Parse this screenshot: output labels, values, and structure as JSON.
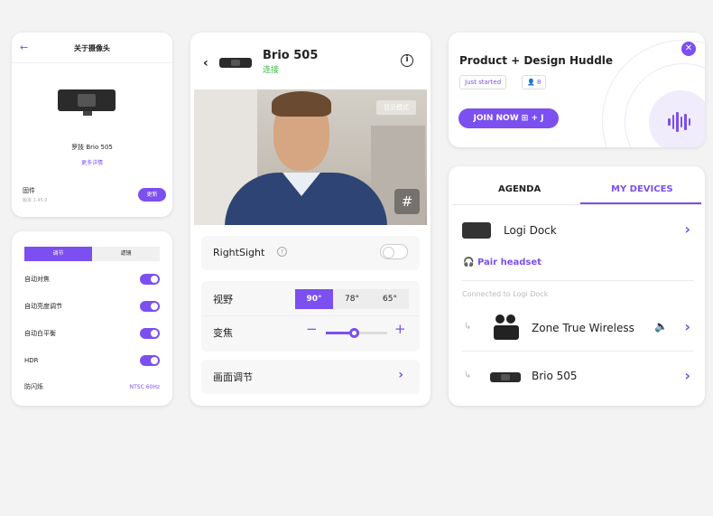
{
  "camera_info": {
    "title": "关于摄像头",
    "device_name": "罗技 Brio 505",
    "more_details": "更多详情",
    "firmware_label": "固件",
    "firmware_version": "版本 1.45.0",
    "update_button": "更新"
  },
  "settings": {
    "tabs": [
      {
        "label": "调节",
        "active": true
      },
      {
        "label": "滤镜",
        "active": false
      }
    ],
    "rows": [
      {
        "label": "自动对焦",
        "value": "on"
      },
      {
        "label": "自动亮度调节",
        "value": "on"
      },
      {
        "label": "自动白平衡",
        "value": "on"
      },
      {
        "label": "HDR",
        "value": "on"
      },
      {
        "label": "防闪烁",
        "value": "NTSC 60Hz"
      }
    ]
  },
  "device_panel": {
    "title": "Brio 505",
    "status": "连接",
    "video_mode_label": "显示模式",
    "rightsight_label": "RightSight",
    "rightsight_enabled": false,
    "fov_label": "视野",
    "fov_options": [
      "90°",
      "78°",
      "65°"
    ],
    "fov_selected": "90°",
    "zoom_label": "变焦",
    "zoom_level_fraction": 0.45,
    "image_adjust_label": "画面调节"
  },
  "meeting": {
    "title": "Product + Design Huddle",
    "status_pill": "Just started",
    "participants": "8",
    "join_button": "JOIN NOW",
    "join_shortcut": "+ J"
  },
  "devices": {
    "tabs": [
      {
        "label": "AGENDA",
        "active": false
      },
      {
        "label": "MY DEVICES",
        "active": true
      }
    ],
    "dock_name": "Logi Dock",
    "pair_headset": "Pair headset",
    "connected_caption": "Connected to Logi Dock",
    "connected": [
      {
        "name": "Zone True Wireless"
      },
      {
        "name": "Brio 505"
      }
    ]
  },
  "colors": {
    "accent": "#7b4ff0",
    "connected": "#3fba4a"
  }
}
